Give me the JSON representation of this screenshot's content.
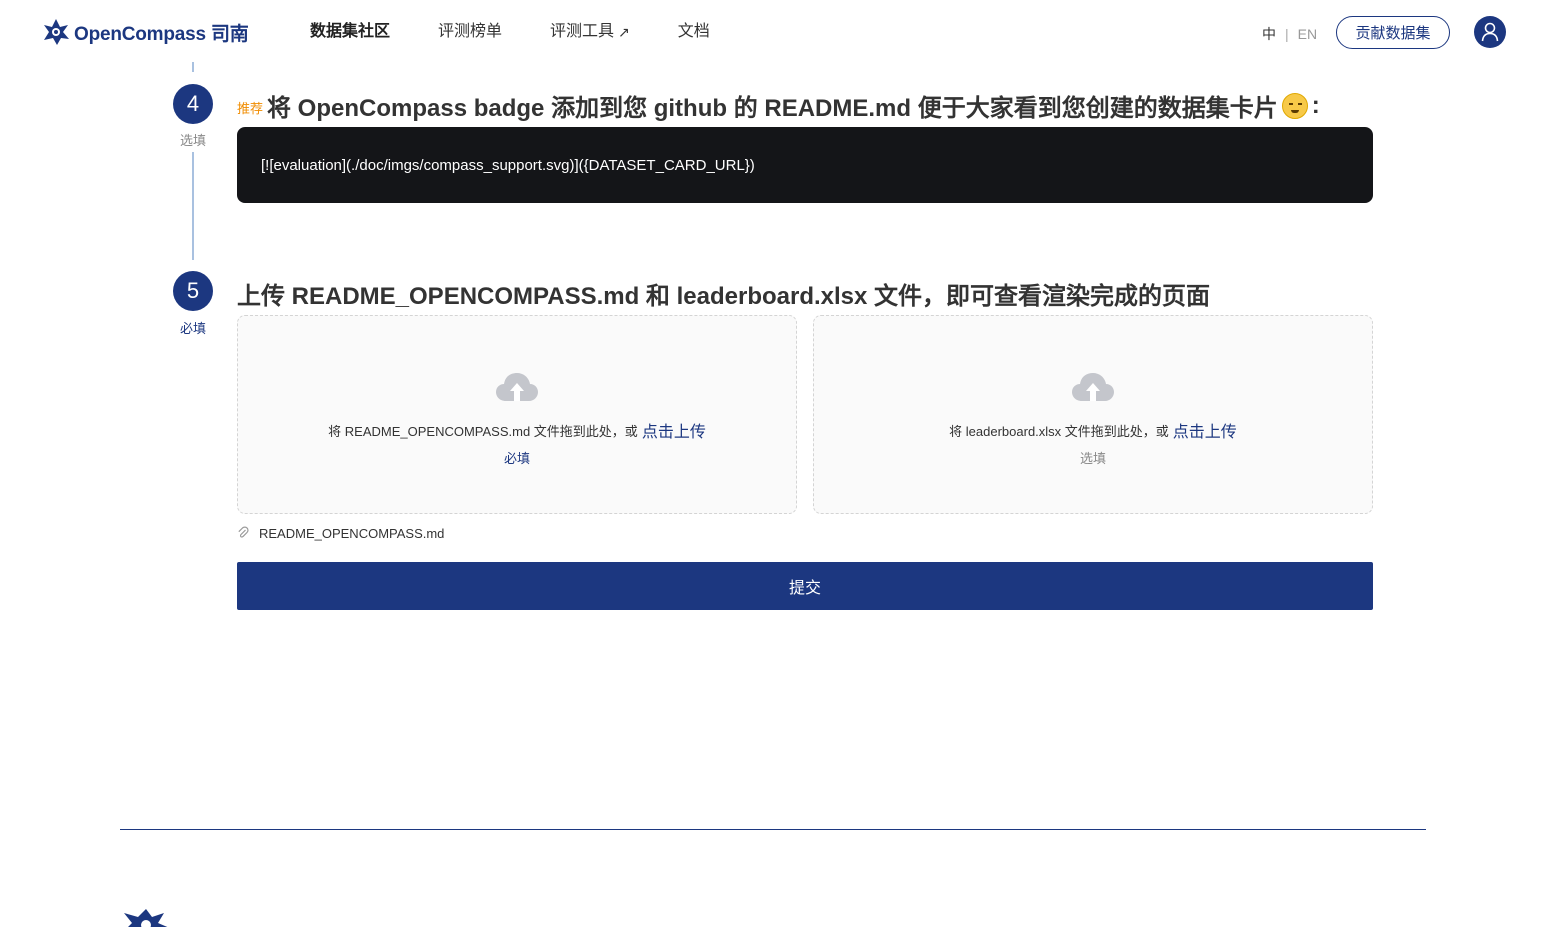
{
  "header": {
    "logo_text": "OpenCompass 司南",
    "nav": [
      {
        "label": "数据集社区",
        "active": true
      },
      {
        "label": "评测榜单"
      },
      {
        "label": "评测工具",
        "external": true
      },
      {
        "label": "文档"
      }
    ],
    "lang_zh": "中",
    "lang_sep": "|",
    "lang_en": "EN",
    "contribute_label": "贡献数据集"
  },
  "steps": {
    "step4": {
      "number": "4",
      "tag": "选填",
      "recommend": "推荐",
      "title": "将 OpenCompass badge 添加到您 github 的 README.md 便于大家看到您创建的数据集卡片",
      "title_suffix": ":",
      "code": "[![evaluation](./doc/imgs/compass_support.svg)]({DATASET_CARD_URL})"
    },
    "step5": {
      "number": "5",
      "tag": "必填",
      "title": "上传 README_OPENCOMPASS.md 和 leaderboard.xlsx 文件，即可查看渲染完成的页面",
      "dropzones": [
        {
          "text": "将 README_OPENCOMPASS.md 文件拖到此处，或",
          "link": "点击上传",
          "requirement": "必填"
        },
        {
          "text": "将 leaderboard.xlsx 文件拖到此处，或",
          "link": "点击上传",
          "requirement": "选填"
        }
      ],
      "attached_file": "README_OPENCOMPASS.md",
      "submit_label": "提交"
    }
  },
  "colors": {
    "brand": "#1c3780",
    "recommend": "#f08c00",
    "code_bg": "#141518"
  }
}
